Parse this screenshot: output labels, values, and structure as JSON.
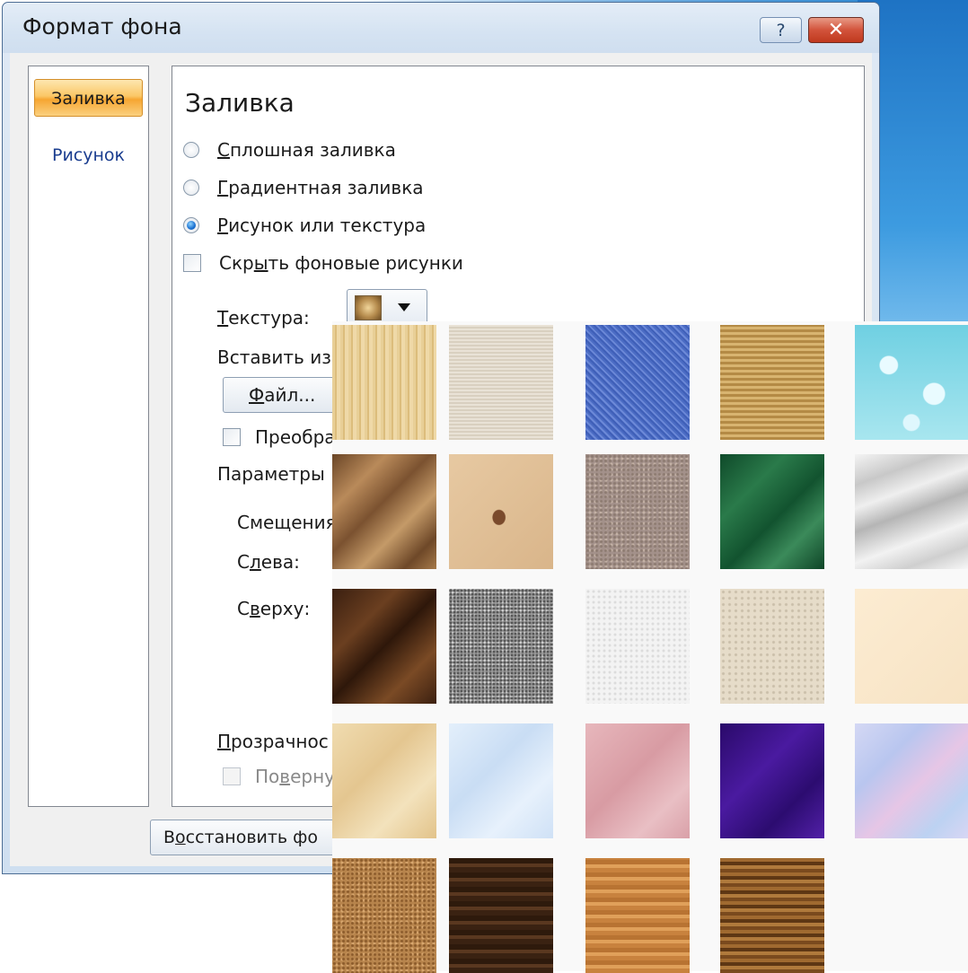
{
  "dialog": {
    "title": "Формат фона",
    "help_label": "?",
    "close_label": "✕"
  },
  "nav": {
    "items": [
      {
        "label": "Заливка",
        "selected": true
      },
      {
        "label": "Рисунок",
        "selected": false
      }
    ]
  },
  "panel": {
    "title": "Заливка",
    "options": {
      "solid_mnemonic": "С",
      "solid_rest": "плошная заливка",
      "gradient_mnemonic": "Г",
      "gradient_rest": "радиентная заливка",
      "picture_mnemonic": "Р",
      "picture_rest": "исунок или текстура",
      "hide_pre": "Скр",
      "hide_mnemonic": "ы",
      "hide_rest": "ть фоновые рисунки"
    },
    "texture_mnemonic": "Т",
    "texture_rest": "екстура:",
    "insert_from": "Вставить из",
    "file_button_mnemonic": "Ф",
    "file_button_rest": "айл...",
    "transform_label": "Преобра",
    "params_label": "Параметры",
    "offsets_label": "Смещения",
    "left_pre": "С",
    "left_mnemonic": "л",
    "left_rest": "ева:",
    "top_pre": "С",
    "top_mnemonic": "в",
    "top_rest": "ерху:",
    "transparency_mnemonic": "П",
    "transparency_rest": "розрачнос",
    "rotate_pre": "По",
    "rotate_mnemonic": "в",
    "rotate_rest": "ерну"
  },
  "footer": {
    "restore_pre": "В",
    "restore_mnemonic": "о",
    "restore_rest": "сстановить фо"
  },
  "gallery": {
    "rows": [
      [
        "papyrus",
        "canvas",
        "denim",
        "sack",
        "water-drops"
      ],
      [
        "paper-bag",
        "fish-fossil",
        "brown-granite",
        "green-marble",
        "white-marble"
      ],
      [
        "brown-marble",
        "granite",
        "white-texture",
        "sand",
        "cream"
      ],
      [
        "parchment",
        "blue-tissue",
        "pink-tissue",
        "purple-mesh",
        "bouquet"
      ],
      [
        "cork",
        "walnut",
        "oak",
        "medium-wood"
      ]
    ]
  },
  "colors": {
    "accent": "#1a3d8f",
    "selected_nav": "#f6a632",
    "close_red": "#c0391f"
  }
}
